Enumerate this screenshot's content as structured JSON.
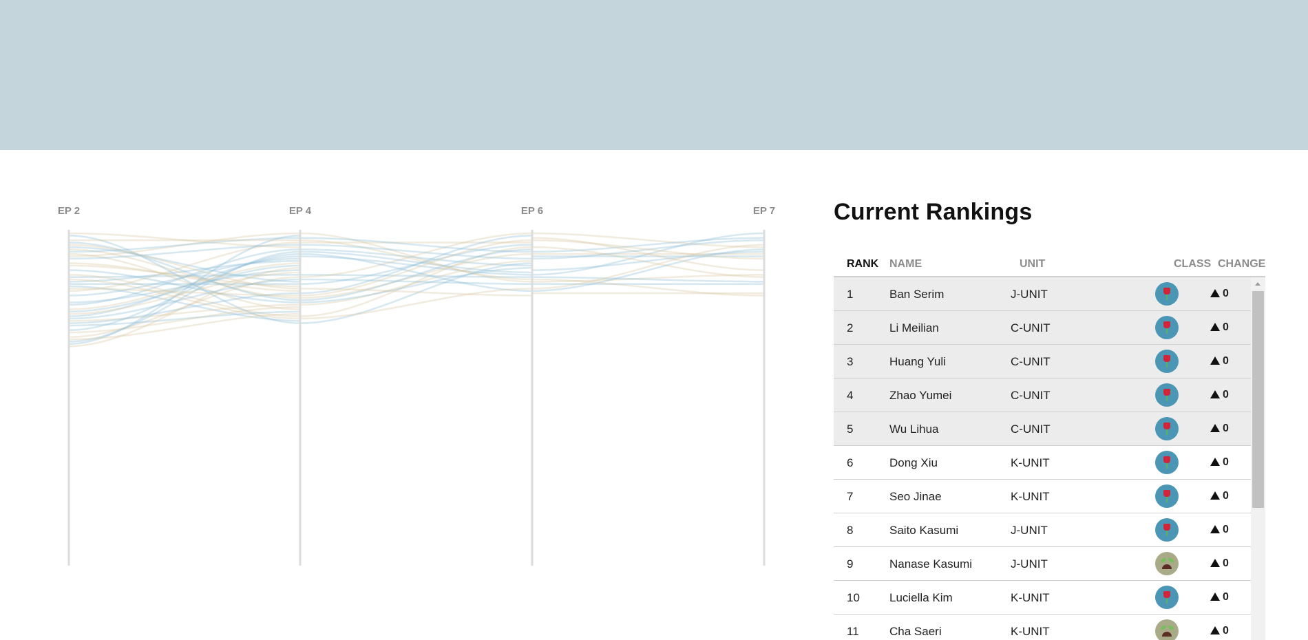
{
  "chart_data": {
    "type": "parallel-coordinates",
    "axes": [
      "EP 2",
      "EP 4",
      "EP 6",
      "EP 7"
    ],
    "trainees_per_axis": [
      50,
      40,
      28,
      28
    ],
    "colors": {
      "blue": "#8bbdd6",
      "tan": "#d7c9a4",
      "axis": "#dcdcdc",
      "label": "#8a8a8a"
    }
  },
  "rankings": {
    "title": "Current Rankings",
    "columns": {
      "rank": "RANK",
      "name": "NAME",
      "unit": "UNIT",
      "class": "CLASS",
      "change": "CHANGE"
    },
    "rows": [
      {
        "rank": "1",
        "name": "Ban Serim",
        "unit": "J-UNIT",
        "class_icon": "rose-icon",
        "change": "0",
        "highlight": true
      },
      {
        "rank": "2",
        "name": "Li Meilian",
        "unit": "C-UNIT",
        "class_icon": "rose-icon",
        "change": "0",
        "highlight": true
      },
      {
        "rank": "3",
        "name": "Huang Yuli",
        "unit": "C-UNIT",
        "class_icon": "rose-icon",
        "change": "0",
        "highlight": true
      },
      {
        "rank": "4",
        "name": "Zhao Yumei",
        "unit": "C-UNIT",
        "class_icon": "rose-icon",
        "change": "0",
        "highlight": true
      },
      {
        "rank": "5",
        "name": "Wu Lihua",
        "unit": "C-UNIT",
        "class_icon": "rose-icon",
        "change": "0",
        "highlight": true
      },
      {
        "rank": "6",
        "name": "Dong Xiu",
        "unit": "K-UNIT",
        "class_icon": "rose-icon",
        "change": "0",
        "highlight": false
      },
      {
        "rank": "7",
        "name": "Seo Jinae",
        "unit": "K-UNIT",
        "class_icon": "rose-icon",
        "change": "0",
        "highlight": false
      },
      {
        "rank": "8",
        "name": "Saito Kasumi",
        "unit": "J-UNIT",
        "class_icon": "rose-icon",
        "change": "0",
        "highlight": false
      },
      {
        "rank": "9",
        "name": "Nanase Kasumi",
        "unit": "J-UNIT",
        "class_icon": "sprout-icon",
        "change": "0",
        "highlight": false
      },
      {
        "rank": "10",
        "name": "Luciella Kim",
        "unit": "K-UNIT",
        "class_icon": "rose-icon",
        "change": "0",
        "highlight": false
      },
      {
        "rank": "11",
        "name": "Cha Saeri",
        "unit": "K-UNIT",
        "class_icon": "sprout-icon",
        "change": "0",
        "highlight": false
      }
    ]
  }
}
